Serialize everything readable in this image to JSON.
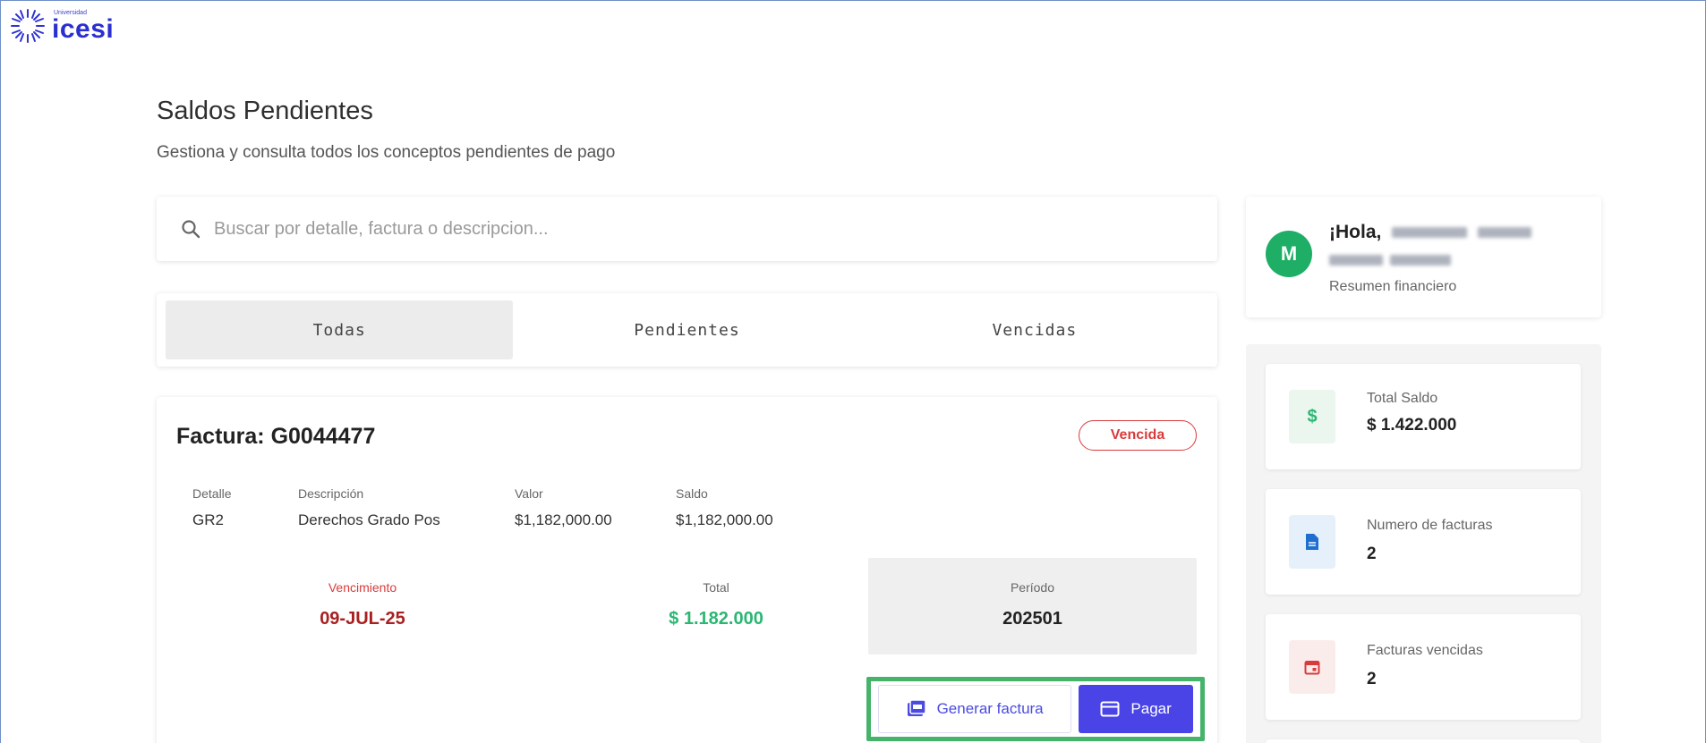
{
  "logo": {
    "small": "Universidad",
    "word": "icesi"
  },
  "page": {
    "title": "Saldos Pendientes",
    "subtitle": "Gestiona y consulta todos los conceptos pendientes de pago"
  },
  "search": {
    "placeholder": "Buscar por detalle, factura o descripcion..."
  },
  "tabs": [
    {
      "label": "Todas",
      "active": true
    },
    {
      "label": "Pendientes",
      "active": false
    },
    {
      "label": "Vencidas",
      "active": false
    }
  ],
  "invoice": {
    "title": "Factura: G0044477",
    "status": "Vencida",
    "columns": [
      {
        "header": "Detalle",
        "value": "GR2"
      },
      {
        "header": "Descripción",
        "value": "Derechos Grado Pos"
      },
      {
        "header": "Valor",
        "value": "$1,182,000.00"
      },
      {
        "header": "Saldo",
        "value": "$1,182,000.00"
      }
    ],
    "vencimiento": {
      "label": "Vencimiento",
      "value": "09-JUL-25"
    },
    "total": {
      "label": "Total",
      "value": "$ 1.182.000"
    },
    "periodo": {
      "label": "Período",
      "value": "202501"
    },
    "actions": {
      "generate": "Generar factura",
      "pay": "Pagar"
    }
  },
  "profile": {
    "avatar_initial": "M",
    "greeting": "¡Hola,",
    "subtitle": "Resumen financiero"
  },
  "stats": [
    {
      "label": "Total Saldo",
      "value": "$ 1.422.000",
      "icon": "dollar-icon"
    },
    {
      "label": "Numero de facturas",
      "value": "2",
      "icon": "document-icon"
    },
    {
      "label": "Facturas vencidas",
      "value": "2",
      "icon": "calendar-icon"
    }
  ],
  "colors": {
    "accent": "#4a44e6",
    "danger": "#d93b3b",
    "success": "#1fae66",
    "highlight": "#45b36a"
  }
}
